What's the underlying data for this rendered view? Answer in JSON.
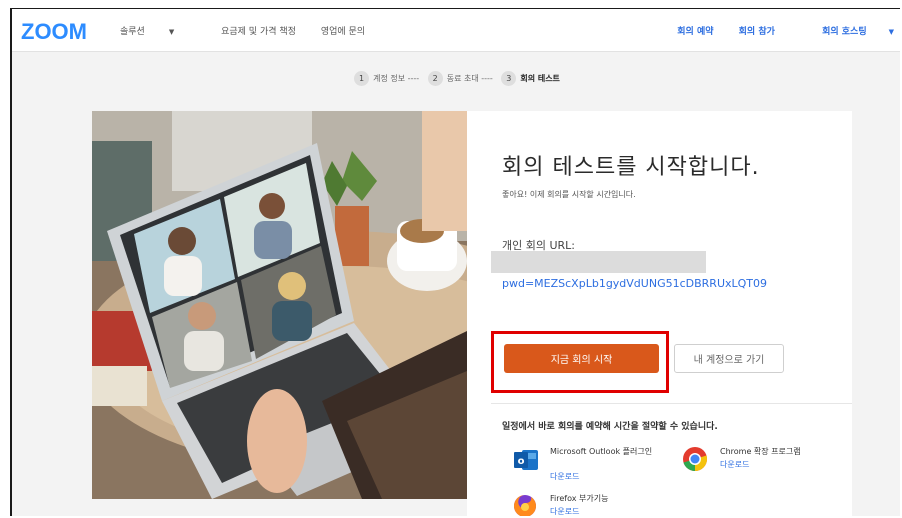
{
  "nav": {
    "logo": "ZOOM",
    "solutions": "솔루션",
    "pricing": "요금제 및 가격 책정",
    "contact_sales": "영업에 문의",
    "schedule": "회의 예약",
    "join": "회의 참가",
    "host": "회의 호스팅"
  },
  "steps": [
    {
      "num": "1",
      "label": "계정 정보 ----"
    },
    {
      "num": "2",
      "label": "동료 초대 ----"
    },
    {
      "num": "3",
      "label": "회의 테스트"
    }
  ],
  "main": {
    "title": "회의 테스트를 시작합니다.",
    "subtitle": "좋아요! 이제 회의를 시작할 시간입니다.",
    "url_label": "개인 회의 URL:",
    "url_value": "pwd=MEZScXpLb1gydVdUNG51cDBRRUxLQT09",
    "start_button": "지금 회의 시작",
    "account_button": "내 계정으로 가기",
    "schedule_text": "일정에서 바로 회의를 예약해 시간을 절약할 수 있습니다."
  },
  "addins": {
    "outlook": {
      "name": "Microsoft Outlook 플러그인",
      "download": "다운로드",
      "icon": "outlook-icon"
    },
    "chrome": {
      "name": "Chrome 확장 프로그램",
      "download": "다운로드",
      "icon": "chrome-icon"
    },
    "firefox": {
      "name": "Firefox 부가기능",
      "download": "다운로드",
      "icon": "firefox-icon"
    }
  },
  "colors": {
    "brand": "#2d8cff",
    "start_button": "#d9581b",
    "link": "#2d6ee0",
    "highlight_box": "#e00000"
  }
}
